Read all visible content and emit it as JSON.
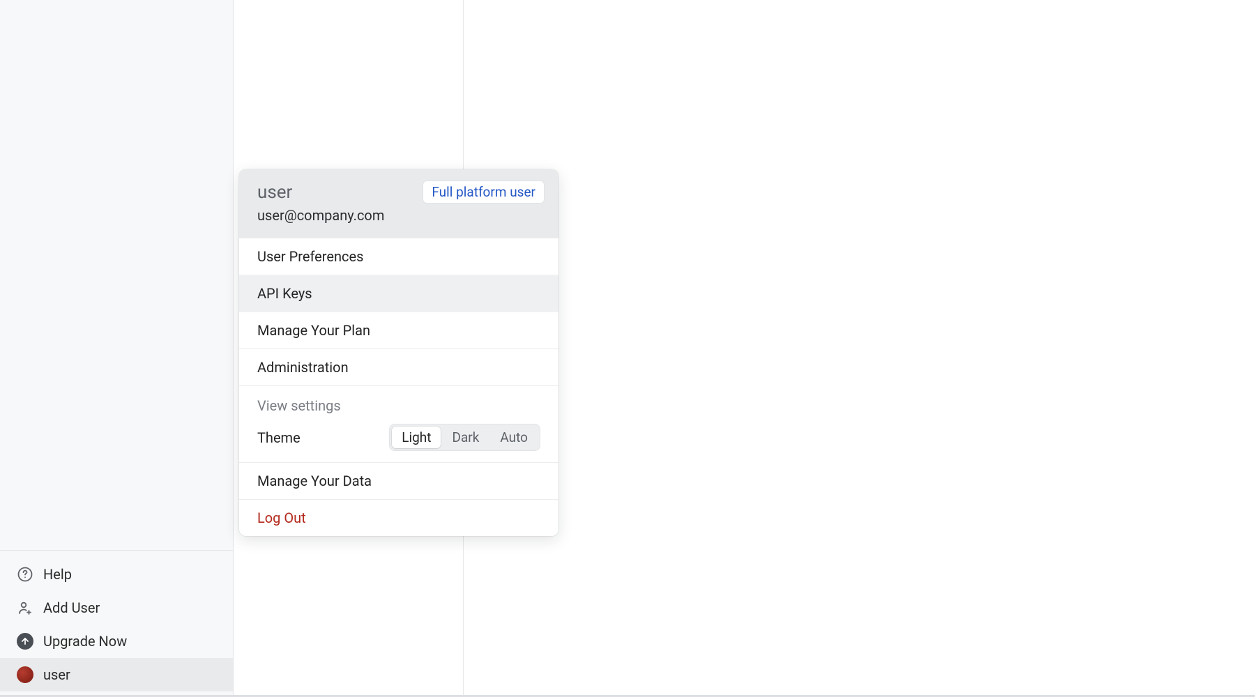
{
  "sidebar": {
    "footer": [
      {
        "key": "help",
        "label": "Help",
        "icon": "help-icon",
        "interactable": true
      },
      {
        "key": "add_user",
        "label": "Add User",
        "icon": "add-user-icon",
        "interactable": true
      },
      {
        "key": "upgrade",
        "label": "Upgrade Now",
        "icon": "upgrade-icon",
        "interactable": true
      },
      {
        "key": "user",
        "label": "user",
        "icon": "avatar-icon",
        "interactable": true,
        "active": true
      }
    ]
  },
  "popover": {
    "username": "user",
    "email": "user@company.com",
    "role_label": "Full platform user",
    "groups": [
      {
        "items": [
          {
            "key": "user_prefs",
            "label": "User Preferences"
          },
          {
            "key": "api_keys",
            "label": "API Keys",
            "hovered": true
          },
          {
            "key": "manage_plan",
            "label": "Manage Your Plan"
          }
        ]
      },
      {
        "items": [
          {
            "key": "administration",
            "label": "Administration"
          }
        ]
      }
    ],
    "view_settings_label": "View settings",
    "theme": {
      "label": "Theme",
      "options": [
        {
          "key": "light",
          "label": "Light",
          "selected": true
        },
        {
          "key": "dark",
          "label": "Dark",
          "selected": false
        },
        {
          "key": "auto",
          "label": "Auto",
          "selected": false
        }
      ]
    },
    "manage_data_label": "Manage Your Data",
    "logout_label": "Log Out"
  }
}
